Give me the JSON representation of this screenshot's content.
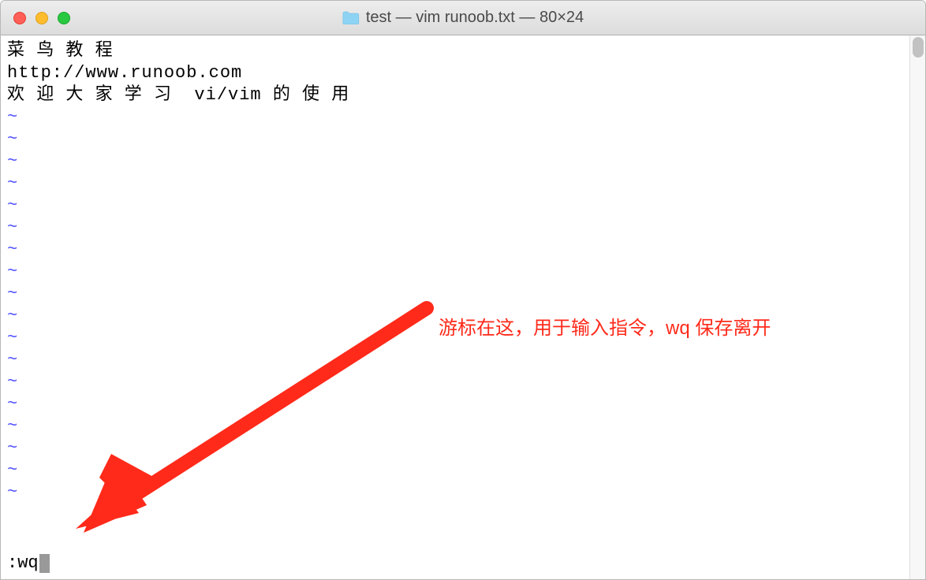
{
  "window": {
    "title": "test — vim runoob.txt — 80×24"
  },
  "editor": {
    "lines": [
      "菜 鸟 教 程",
      "http://www.runoob.com",
      "欢 迎 大 家 学 习  vi/vim 的 使 用"
    ],
    "tilde_marker": "~",
    "empty_line_count": 18,
    "command": ":wq"
  },
  "annotation": {
    "text": "游标在这，用于输入指令，wq 保存离开"
  },
  "colors": {
    "tilde": "#5050ff",
    "annotation": "#ff2a1a"
  }
}
